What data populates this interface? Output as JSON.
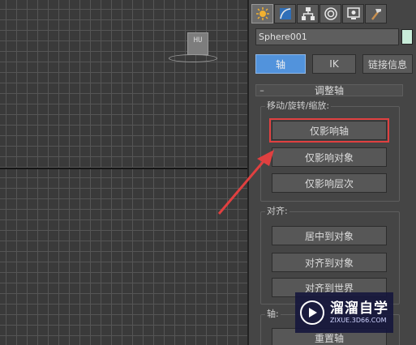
{
  "viewport": {
    "viewcube_label": "HU"
  },
  "command_panel": {
    "tabs": [
      {
        "icon": "create-icon",
        "active": true
      },
      {
        "icon": "modify-icon",
        "active": false
      },
      {
        "icon": "hierarchy-icon",
        "active": false
      },
      {
        "icon": "motion-icon",
        "active": false
      },
      {
        "icon": "display-icon",
        "active": false
      },
      {
        "icon": "utilities-icon",
        "active": false
      }
    ],
    "object_name": "Sphere001",
    "object_color": "#c8ecd9",
    "modes": {
      "pivot": "轴",
      "ik": "IK",
      "link_info": "链接信息"
    },
    "rollout": {
      "collapse": "–",
      "title": "调整轴"
    },
    "move_rotate_scale": {
      "label": "移动/旋转/缩放:",
      "affect_pivot_only": "仅影响轴",
      "affect_object_only": "仅影响对象",
      "affect_hierarchy_only": "仅影响层次"
    },
    "alignment": {
      "label": "对齐:",
      "center_to_object": "居中到对象",
      "align_to_object": "对齐到对象",
      "align_to_world": "对齐到世界"
    },
    "pivot_group": {
      "label": "轴:",
      "reset_pivot": "重置轴"
    }
  },
  "accent_color": "#5293dc",
  "annotation_color": "#e04040",
  "watermark": {
    "title": "溜溜自学",
    "url": "ZIXUE.3D66.COM"
  }
}
